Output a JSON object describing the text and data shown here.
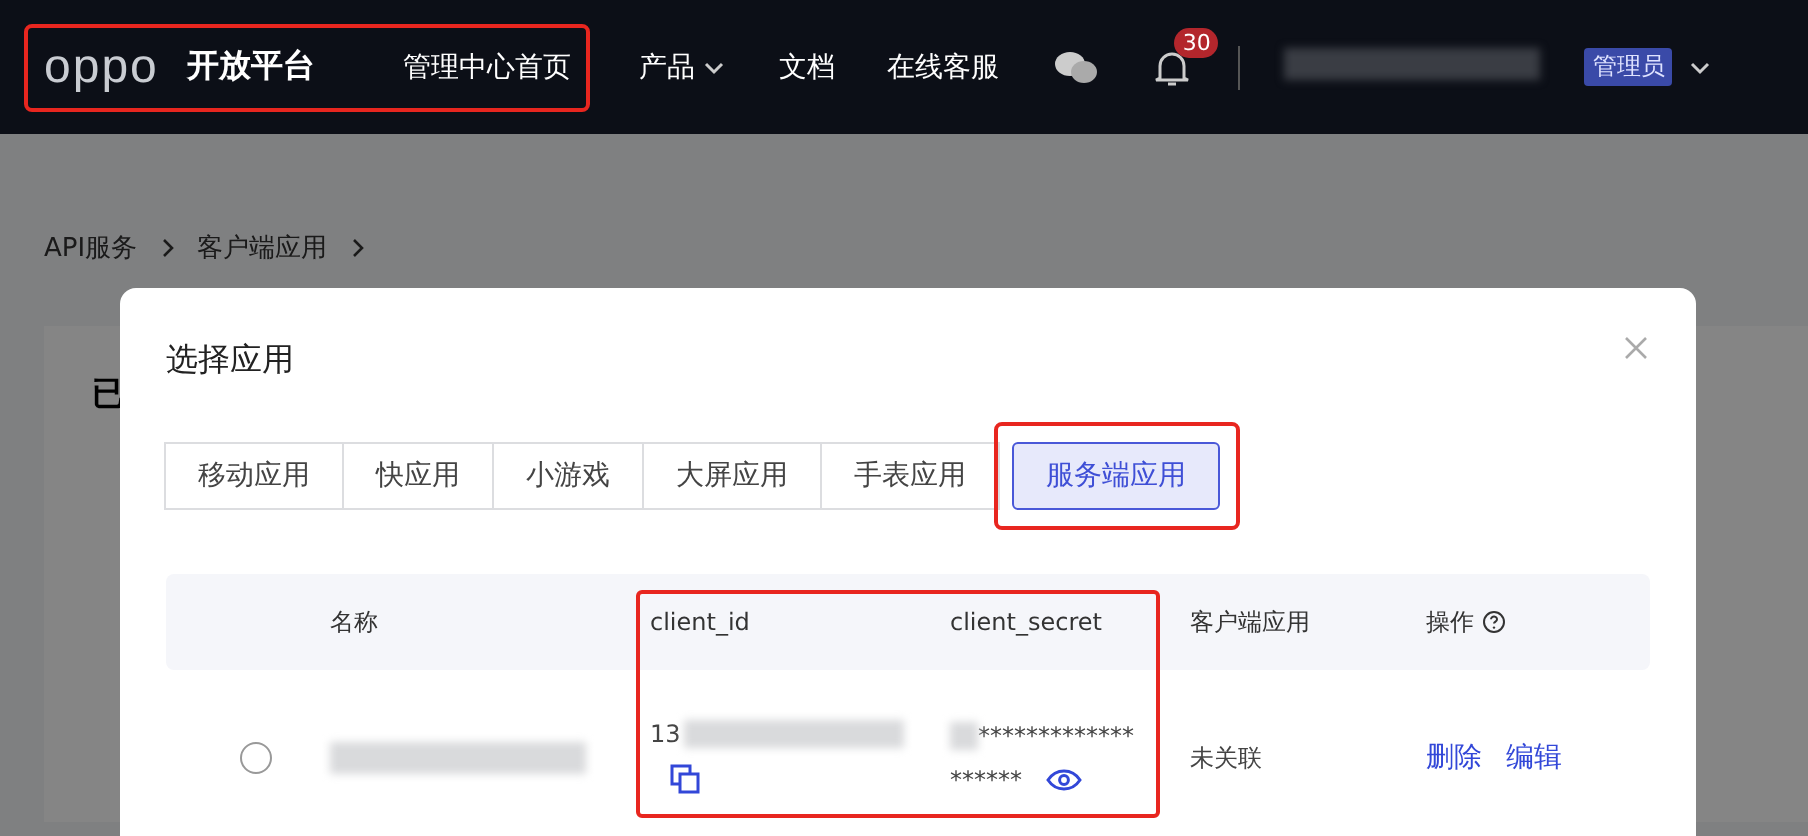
{
  "header": {
    "logo": "oppo",
    "title": "开放平台",
    "home_link": "管理中心首页",
    "nav": [
      {
        "label": "产品",
        "has_menu": true
      },
      {
        "label": "文档",
        "has_menu": false
      },
      {
        "label": "在线客服",
        "has_menu": false
      }
    ],
    "notification_count": "30",
    "role": "管理员"
  },
  "breadcrumb": [
    "API服务",
    "客户端应用"
  ],
  "card_title": "已",
  "dialog": {
    "title": "选择应用",
    "tabs": [
      {
        "label": "移动应用",
        "selected": false
      },
      {
        "label": "快应用",
        "selected": false
      },
      {
        "label": "小游戏",
        "selected": false
      },
      {
        "label": "大屏应用",
        "selected": false
      },
      {
        "label": "手表应用",
        "selected": false
      },
      {
        "label": "服务端应用",
        "selected": true
      }
    ],
    "table": {
      "columns": [
        "名称",
        "client_id",
        "client_secret",
        "客户端应用",
        "操作"
      ],
      "rows": [
        {
          "selected": false,
          "client_id": "13",
          "client_secret": [
            "*************",
            "******"
          ],
          "client_app": "未关联",
          "actions": [
            "删除",
            "编辑"
          ]
        }
      ]
    }
  }
}
